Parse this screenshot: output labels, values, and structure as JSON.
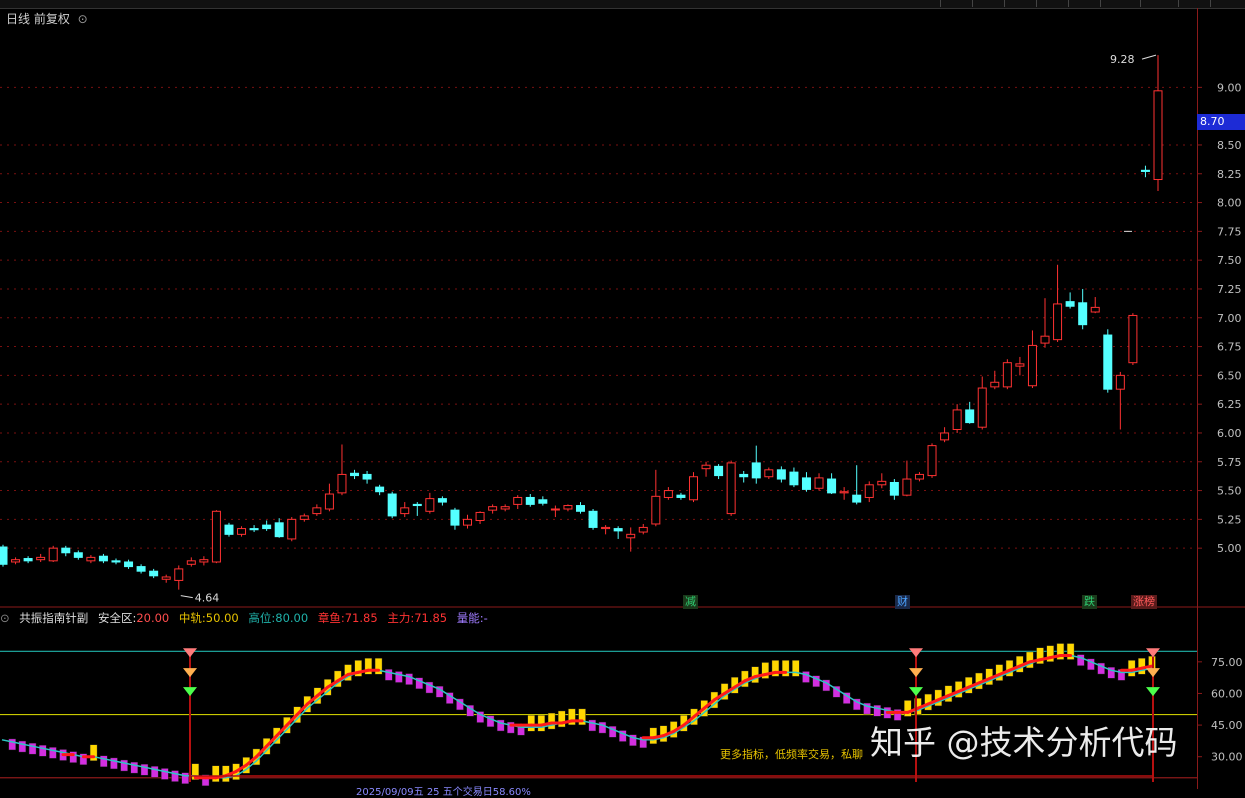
{
  "header": {
    "title": "日线 前复权",
    "icon": "chevron-circle-icon"
  },
  "price_panel": {
    "current_price_tag": "8.70",
    "high_label": "9.28",
    "low_label": "4.64",
    "markers": [
      {
        "text": "减",
        "color": "#2ecc71",
        "bg": "#1b3a1b"
      },
      {
        "text": "财",
        "color": "#4aa3ff",
        "bg": "#1b2a4a"
      },
      {
        "text": "跌",
        "color": "#2ecc71",
        "bg": "#1b3a1b"
      },
      {
        "text": "涨榜",
        "color": "#ff5a5a",
        "bg": "#5a1b1b"
      }
    ]
  },
  "indicator": {
    "name": "共振指南针副",
    "params": [
      {
        "label": "安全区:",
        "value": "20.00",
        "color": "#ff4d4d"
      },
      {
        "label": "中轨:",
        "value": "50.00",
        "color": "#e6c200"
      },
      {
        "label": "高位:",
        "value": "80.00",
        "color": "#20b2aa"
      },
      {
        "label": "章鱼:",
        "value": "71.85",
        "color": "#ff3333"
      },
      {
        "label": "主力:",
        "value": "71.85",
        "color": "#ff3333"
      },
      {
        "label": "量能:",
        "value": "-",
        "color": "#a07cff"
      }
    ],
    "promo_text": "更多指标，低频率交易，私聊",
    "date_bar": "2025/09/09五 25 五个交易日58.60%"
  },
  "watermark": "知乎 @技术分析代码",
  "colors": {
    "up": "#ff3232",
    "down": "#54ffff",
    "grid": "#7a1010",
    "axis_text": "#c0c0c0"
  },
  "chart_data": [
    {
      "type": "candlestick",
      "title": "日线 前复权",
      "y_ticks": [
        5.0,
        5.25,
        5.5,
        5.75,
        6.0,
        6.25,
        6.5,
        6.75,
        7.0,
        7.25,
        7.5,
        7.75,
        8.0,
        8.25,
        8.5,
        9.0
      ],
      "ylim": [
        4.55,
        9.55
      ],
      "candles": [
        [
          5.01,
          4.86,
          5.03,
          4.84
        ],
        [
          4.88,
          4.9,
          4.92,
          4.86
        ],
        [
          4.91,
          4.89,
          4.93,
          4.87
        ],
        [
          4.9,
          4.92,
          4.95,
          4.88
        ],
        [
          4.89,
          5.0,
          5.02,
          4.88
        ],
        [
          5.0,
          4.96,
          5.02,
          4.93
        ],
        [
          4.96,
          4.92,
          4.98,
          4.9
        ],
        [
          4.89,
          4.92,
          4.94,
          4.87
        ],
        [
          4.93,
          4.89,
          4.95,
          4.87
        ],
        [
          4.89,
          4.88,
          4.91,
          4.86
        ],
        [
          4.88,
          4.84,
          4.9,
          4.82
        ],
        [
          4.84,
          4.8,
          4.86,
          4.78
        ],
        [
          4.8,
          4.76,
          4.82,
          4.74
        ],
        [
          4.73,
          4.75,
          4.77,
          4.7
        ],
        [
          4.72,
          4.82,
          4.85,
          4.64
        ],
        [
          4.86,
          4.89,
          4.92,
          4.84
        ],
        [
          4.88,
          4.9,
          4.93,
          4.85
        ],
        [
          4.88,
          5.32,
          5.33,
          4.87
        ],
        [
          5.2,
          5.12,
          5.22,
          5.1
        ],
        [
          5.12,
          5.17,
          5.19,
          5.1
        ],
        [
          5.17,
          5.16,
          5.2,
          5.14
        ],
        [
          5.2,
          5.17,
          5.24,
          5.15
        ],
        [
          5.22,
          5.1,
          5.26,
          5.09
        ],
        [
          5.08,
          5.25,
          5.27,
          5.06
        ],
        [
          5.25,
          5.28,
          5.3,
          5.23
        ],
        [
          5.3,
          5.35,
          5.38,
          5.28
        ],
        [
          5.34,
          5.47,
          5.56,
          5.32
        ],
        [
          5.48,
          5.64,
          5.9,
          5.46
        ],
        [
          5.65,
          5.63,
          5.68,
          5.6
        ],
        [
          5.64,
          5.6,
          5.67,
          5.56
        ],
        [
          5.53,
          5.49,
          5.55,
          5.46
        ],
        [
          5.47,
          5.28,
          5.49,
          5.26
        ],
        [
          5.3,
          5.35,
          5.4,
          5.27
        ],
        [
          5.38,
          5.37,
          5.4,
          5.28
        ],
        [
          5.32,
          5.43,
          5.48,
          5.3
        ],
        [
          5.43,
          5.4,
          5.45,
          5.37
        ],
        [
          5.33,
          5.2,
          5.35,
          5.16
        ],
        [
          5.2,
          5.25,
          5.29,
          5.17
        ],
        [
          5.24,
          5.31,
          5.32,
          5.21
        ],
        [
          5.33,
          5.36,
          5.38,
          5.3
        ],
        [
          5.34,
          5.36,
          5.38,
          5.32
        ],
        [
          5.38,
          5.44,
          5.46,
          5.34
        ],
        [
          5.44,
          5.38,
          5.47,
          5.36
        ],
        [
          5.42,
          5.39,
          5.45,
          5.37
        ],
        [
          5.34,
          5.34,
          5.37,
          5.27
        ],
        [
          5.34,
          5.37,
          5.38,
          5.32
        ],
        [
          5.37,
          5.32,
          5.4,
          5.3
        ],
        [
          5.32,
          5.18,
          5.34,
          5.16
        ],
        [
          5.17,
          5.18,
          5.2,
          5.12
        ],
        [
          5.17,
          5.15,
          5.19,
          5.08
        ],
        [
          5.09,
          5.12,
          5.18,
          4.97
        ],
        [
          5.14,
          5.18,
          5.21,
          5.12
        ],
        [
          5.21,
          5.45,
          5.68,
          5.19
        ],
        [
          5.44,
          5.5,
          5.53,
          5.42
        ],
        [
          5.46,
          5.44,
          5.48,
          5.42
        ],
        [
          5.42,
          5.62,
          5.66,
          5.4
        ],
        [
          5.69,
          5.72,
          5.75,
          5.62
        ],
        [
          5.71,
          5.63,
          5.73,
          5.6
        ],
        [
          5.3,
          5.74,
          5.76,
          5.28
        ],
        [
          5.64,
          5.62,
          5.67,
          5.57
        ],
        [
          5.74,
          5.61,
          5.89,
          5.56
        ],
        [
          5.62,
          5.68,
          5.7,
          5.6
        ],
        [
          5.68,
          5.6,
          5.71,
          5.57
        ],
        [
          5.66,
          5.55,
          5.7,
          5.53
        ],
        [
          5.61,
          5.51,
          5.66,
          5.49
        ],
        [
          5.52,
          5.61,
          5.65,
          5.5
        ],
        [
          5.6,
          5.48,
          5.65,
          5.47
        ],
        [
          5.48,
          5.49,
          5.53,
          5.42
        ],
        [
          5.46,
          5.4,
          5.72,
          5.38
        ],
        [
          5.44,
          5.55,
          5.58,
          5.4
        ],
        [
          5.55,
          5.58,
          5.65,
          5.52
        ],
        [
          5.57,
          5.46,
          5.6,
          5.42
        ],
        [
          5.46,
          5.6,
          5.76,
          5.45
        ],
        [
          5.6,
          5.64,
          5.66,
          5.58
        ],
        [
          5.63,
          5.89,
          5.91,
          5.61
        ],
        [
          5.94,
          6.0,
          6.05,
          5.92
        ],
        [
          6.03,
          6.2,
          6.25,
          6.0
        ],
        [
          6.2,
          6.09,
          6.27,
          6.08
        ],
        [
          6.05,
          6.39,
          6.49,
          6.03
        ],
        [
          6.4,
          6.44,
          6.54,
          6.38
        ],
        [
          6.4,
          6.61,
          6.64,
          6.38
        ],
        [
          6.58,
          6.6,
          6.66,
          6.5
        ],
        [
          6.41,
          6.76,
          6.89,
          6.39
        ],
        [
          6.78,
          6.84,
          7.17,
          6.74
        ],
        [
          6.81,
          7.12,
          7.46,
          6.79
        ],
        [
          7.14,
          7.1,
          7.22,
          7.08
        ],
        [
          7.13,
          6.94,
          7.25,
          6.9
        ],
        [
          7.05,
          7.09,
          7.18,
          7.04
        ],
        [
          6.85,
          6.38,
          6.9,
          6.35
        ],
        [
          6.38,
          6.5,
          6.53,
          6.03
        ],
        [
          6.61,
          7.02,
          7.04,
          6.59
        ],
        [
          8.28,
          8.27,
          8.32,
          8.22
        ],
        [
          8.2,
          8.97,
          9.28,
          8.1
        ]
      ]
    },
    {
      "type": "line",
      "title": "共振指南针副",
      "y_ticks": [
        30.0,
        45.0,
        60.0,
        75.0
      ],
      "ylim": [
        18,
        92
      ],
      "reference_lines": [
        20.0,
        50.0,
        80.0
      ],
      "series": [
        {
          "name": "章鱼",
          "values": [
            38,
            37,
            36,
            35,
            34,
            33,
            32,
            31,
            30,
            30,
            29,
            28,
            27,
            26,
            25,
            24,
            23,
            22,
            21,
            21,
            20,
            20,
            20,
            21,
            24,
            28,
            33,
            38,
            43,
            48,
            53,
            57,
            61,
            65,
            68,
            70,
            71,
            71,
            70,
            69,
            68,
            66,
            64,
            62,
            59,
            56,
            53,
            50,
            48,
            46,
            45,
            44,
            44,
            44,
            45,
            46,
            47,
            47,
            46,
            45,
            43,
            41,
            39,
            38,
            38,
            39,
            41,
            44,
            47,
            51,
            55,
            59,
            62,
            65,
            67,
            69,
            70,
            70,
            70,
            69,
            67,
            65,
            62,
            59,
            56,
            54,
            53,
            52,
            51,
            51,
            52,
            54,
            56,
            58,
            60,
            62,
            64,
            66,
            68,
            70,
            72,
            74,
            76,
            77,
            78,
            78,
            77,
            75,
            73,
            71,
            70,
            70,
            71,
            72
          ]
        },
        {
          "name": "主力",
          "values": [
            37,
            36,
            35,
            34,
            33,
            32,
            31,
            31,
            30,
            30,
            29,
            28,
            27,
            26,
            25,
            24,
            23,
            22,
            21,
            20,
            20,
            20,
            21,
            23,
            26,
            30,
            35,
            40,
            45,
            50,
            55,
            59,
            63,
            66,
            69,
            70,
            71,
            71,
            70,
            69,
            67,
            65,
            62,
            59,
            56,
            53,
            50,
            48,
            47,
            46,
            45,
            45,
            45,
            45,
            46,
            46,
            47,
            47,
            46,
            45,
            43,
            41,
            40,
            39,
            39,
            40,
            42,
            45,
            49,
            53,
            57,
            60,
            63,
            66,
            68,
            69,
            70,
            70,
            69,
            68,
            66,
            64,
            61,
            58,
            55,
            53,
            52,
            51,
            51,
            51,
            53,
            55,
            57,
            59,
            61,
            63,
            65,
            67,
            69,
            71,
            73,
            75,
            76,
            77,
            78,
            78,
            77,
            75,
            73,
            72,
            71,
            71,
            72,
            73
          ]
        }
      ]
    }
  ]
}
